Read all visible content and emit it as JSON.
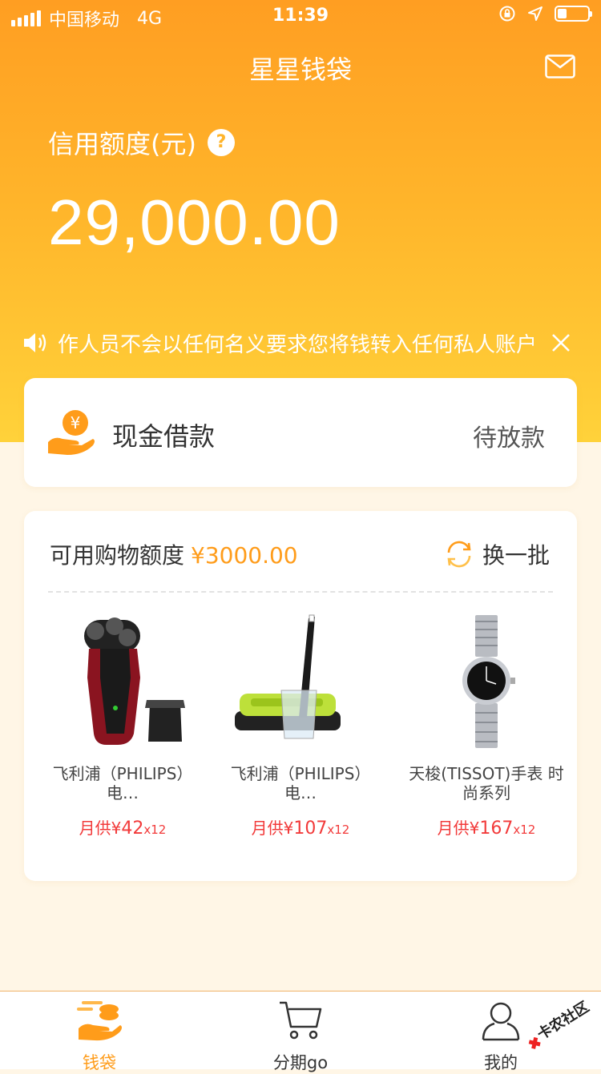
{
  "status_bar": {
    "carrier": "中国移动",
    "network": "4G",
    "time": "11:39",
    "battery_level": 0.3
  },
  "header": {
    "title": "星星钱袋"
  },
  "credit": {
    "label": "信用额度(元)",
    "help": "?",
    "amount": "29,000.00"
  },
  "notice": {
    "text": "作人员不会以任何名义要求您将钱转入任何私人账户（如"
  },
  "cash_loan": {
    "label": "现金借款",
    "status": "待放款"
  },
  "shopping": {
    "label": "可用购物额度",
    "amount": "¥3000.00",
    "refresh_label": "换一批",
    "products": [
      {
        "name": "飞利浦（PHILIPS）电…",
        "price_prefix": "月供¥",
        "price": "42",
        "term": "x12",
        "image": "shaver"
      },
      {
        "name": "飞利浦（PHILIPS）电…",
        "price_prefix": "月供¥",
        "price": "107",
        "term": "x12",
        "image": "toothbrush"
      },
      {
        "name": "天梭(TISSOT)手表 时尚系列",
        "price_prefix": "月供¥",
        "price": "167",
        "term": "x12",
        "image": "watch"
      }
    ]
  },
  "tabs": [
    {
      "label": "钱袋",
      "icon": "wallet-icon",
      "active": true
    },
    {
      "label": "分期go",
      "icon": "cart-icon",
      "active": false
    },
    {
      "label": "我的",
      "icon": "user-icon",
      "active": false
    }
  ],
  "watermark": {
    "text": "卡农社区"
  },
  "colors": {
    "accent": "#ff9c1a",
    "price": "#f23a3a",
    "hero_top": "#ff9e22",
    "hero_bottom": "#ffd23a"
  }
}
